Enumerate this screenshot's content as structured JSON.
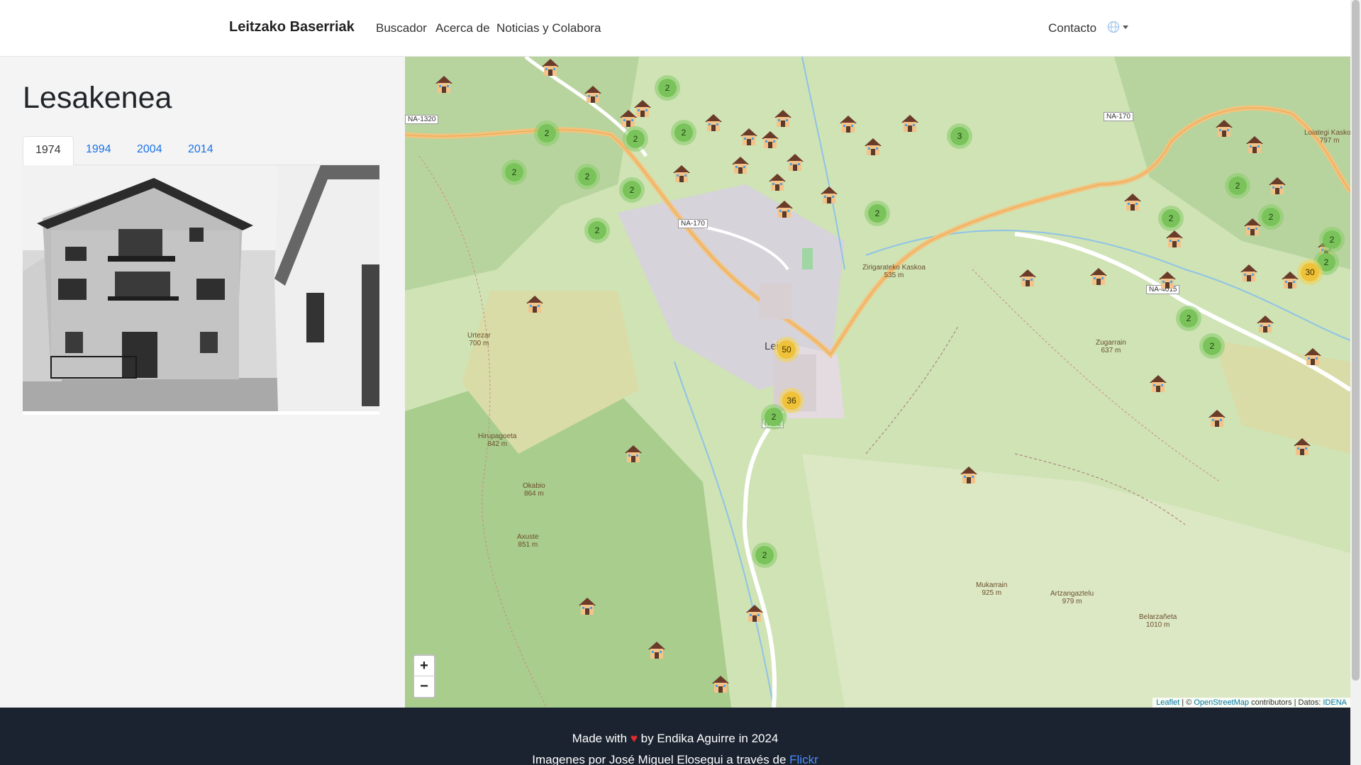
{
  "navbar": {
    "brand": "Leitzako Baserriak",
    "links": [
      "Buscador",
      "Acerca de",
      "Noticias y Colabora"
    ],
    "contact": "Contacto",
    "language_icon": "globe-icon"
  },
  "sidebar": {
    "title": "Lesakenea",
    "tabs": [
      "1974",
      "1994",
      "2004",
      "2014"
    ],
    "active_tab": "1974"
  },
  "map": {
    "town": "Leitza",
    "clusters": [
      "2",
      "2",
      "2",
      "2",
      "2",
      "2",
      "2",
      "2",
      "2",
      "3",
      "2",
      "2",
      "2",
      "2",
      "2",
      "2",
      "2",
      "2",
      "30",
      "50",
      "36",
      "2",
      "2"
    ],
    "places": [
      {
        "name": "Urtezar",
        "elev": "700 m"
      },
      {
        "name": "Hirupagoeta",
        "elev": "842 m"
      },
      {
        "name": "Okabio",
        "elev": "864 m"
      },
      {
        "name": "Axuste",
        "elev": "851 m"
      },
      {
        "name": "Zirigarateko Kaskoa",
        "elev": "535 m"
      },
      {
        "name": "Zugarrain",
        "elev": "637 m"
      },
      {
        "name": "Mukarrain",
        "elev": "925 m"
      },
      {
        "name": "Artzangaztelu",
        "elev": "979 m"
      },
      {
        "name": "Belarzañeta",
        "elev": "1010 m"
      },
      {
        "name": "Loiategi Kaskoa",
        "elev": "797 m"
      }
    ],
    "roads": [
      "NA-1320",
      "NA-170",
      "NA-170",
      "NA-4015",
      "NA-1"
    ],
    "zoom_in": "+",
    "zoom_out": "−",
    "attribution": {
      "leaflet": "Leaflet",
      "sep1": " | © ",
      "osm": "OpenStreetMap",
      "mid": " contributors | Datos: ",
      "idena": "IDENA"
    }
  },
  "footer": {
    "made_with": "Made with",
    "heart": "♥",
    "by": "by Endika Aguirre in 2024",
    "images_prefix": "Imagenes por José Miguel Elosegui a través de",
    "flickr": "Flickr"
  }
}
